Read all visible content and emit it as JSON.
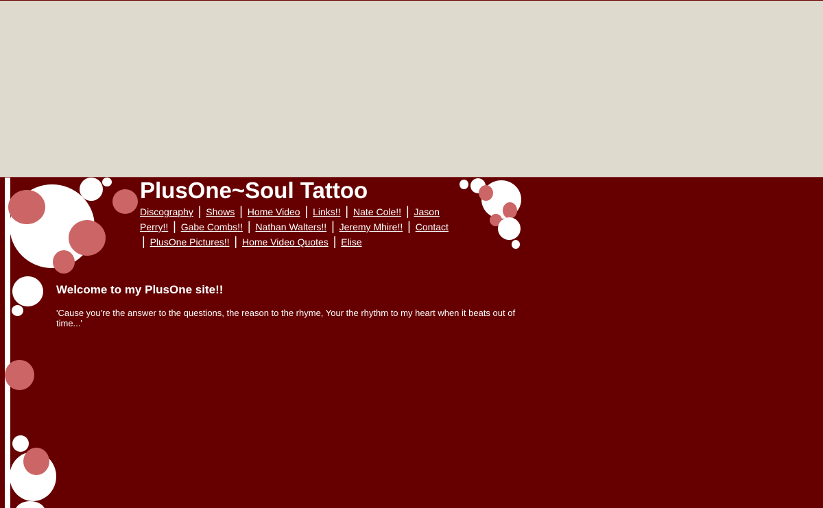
{
  "site": {
    "title": "PlusOne~Soul Tattoo",
    "nav": [
      {
        "label": "Discography",
        "name": "discography"
      },
      {
        "label": "Shows",
        "name": "shows"
      },
      {
        "label": "Home Video",
        "name": "home-video"
      },
      {
        "label": "Links!!",
        "name": "links"
      },
      {
        "label": "Nate Cole!!",
        "name": "nate-cole"
      },
      {
        "label": "Jason Perry!!",
        "name": "jason-perry"
      },
      {
        "label": "Gabe Combs!!",
        "name": "gabe-combs"
      },
      {
        "label": "Nathan Walters!!",
        "name": "nathan-walters"
      },
      {
        "label": "Jeremy Mhire!!",
        "name": "jeremy-mhire"
      },
      {
        "label": "Contact",
        "name": "contact"
      },
      {
        "label": "PlusOne Pictures!!",
        "name": "plusone-pictures"
      },
      {
        "label": "Home Video Quotes",
        "name": "home-video-quotes"
      },
      {
        "label": "Elise",
        "name": "elise"
      }
    ],
    "nav_separator": "|",
    "welcome": "Welcome to my PlusOne site!!",
    "quote": "'Cause you're the answer to the questions, the reason to the rhyme, Your the rhythm to my heart when it beats out of time...'"
  },
  "colors": {
    "page_background": "#dedace",
    "content_background": "#660000",
    "bubble_white": "#ffffff",
    "bubble_pink": "#cc6666",
    "text": "#ffffff"
  }
}
